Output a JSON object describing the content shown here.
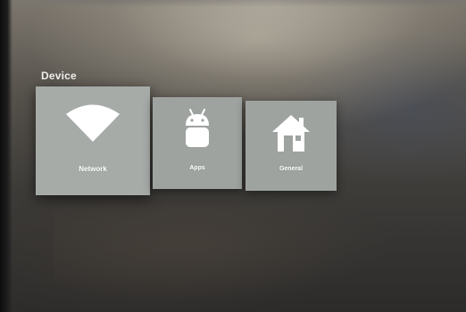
{
  "section": {
    "title": "Device"
  },
  "tiles": [
    {
      "id": "network",
      "label": "Network",
      "icon": "wifi-icon",
      "focused": true
    },
    {
      "id": "apps",
      "label": "Apps",
      "icon": "android-icon",
      "focused": false
    },
    {
      "id": "general",
      "label": "General",
      "icon": "home-icon",
      "focused": false
    }
  ],
  "colors": {
    "tile_background": "#9ea3a0",
    "tile_icon": "#ffffff",
    "label_text": "#ffffff",
    "section_title": "#f0efec"
  }
}
